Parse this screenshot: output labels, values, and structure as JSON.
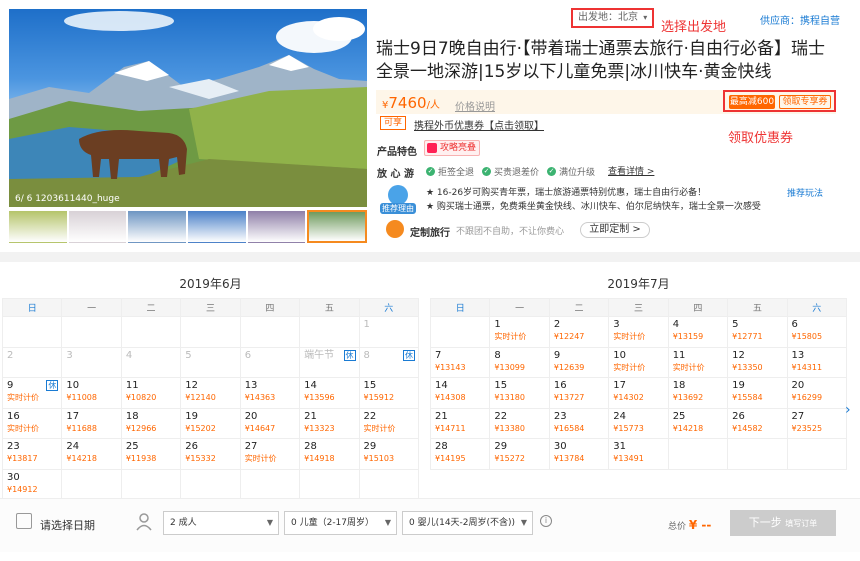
{
  "gallery": {
    "caption": "6/ 6 1203611440_huge",
    "thumb_colors": [
      "#b5c46a",
      "#d8d1d6",
      "#6d95c2",
      "#4a80c8",
      "#8f7fa8",
      "#6f9a5d"
    ]
  },
  "header": {
    "departure": "出发地：北京",
    "departure_annotation": "选择出发地",
    "supplier": "供应商：携程自营",
    "title": "瑞士9日7晚自由行·【带着瑞士通票去旅行·自由行必备】瑞士全景一地深游|15岁以下儿童免票|冰川快车·黄金快线"
  },
  "price": {
    "symbol": "¥",
    "amount": "7460",
    "unit": "/人",
    "note": "价格说明",
    "coupon_tag": "最高减600",
    "coupon_button": "领取专享券",
    "coupon_annotation": "领取优惠券",
    "ketao_tag": "可享",
    "ketao_text": "携程外币优惠券【点击领取】"
  },
  "features": {
    "label": "产品特色",
    "button": "攻略亮叠",
    "fangxin_label": "放 心 游",
    "items": [
      "拒签全退",
      "买贵退差价",
      "满位升级"
    ],
    "detail_link": "查看详情 >",
    "tips": [
      "★ 16-26岁可购买青年票，瑞士旅游通票特别优惠，瑞士自由行必备！",
      "★ 购买瑞士通票，免费乘坐黄金快线、冰川快车、伯尔尼纳快车，瑞士全景一次感受"
    ],
    "tip_badge": "推荐理由",
    "recommend_link": "推荐玩法",
    "custom_label": "定制旅行",
    "custom_sub": "不跟团不自助，不让你费心",
    "custom_button": "立即定制 >"
  },
  "calendar": {
    "weekdays": [
      "日",
      "一",
      "二",
      "三",
      "四",
      "五",
      "六"
    ],
    "june": {
      "title": "2019年6月",
      "rows": [
        [
          {
            "d": ""
          },
          {
            "d": ""
          },
          {
            "d": ""
          },
          {
            "d": ""
          },
          {
            "d": ""
          },
          {
            "d": ""
          },
          {
            "d": "1",
            "g": true
          }
        ],
        [
          {
            "d": "2",
            "g": true
          },
          {
            "d": "3",
            "g": true
          },
          {
            "d": "4",
            "g": true
          },
          {
            "d": "5",
            "g": true
          },
          {
            "d": "6",
            "g": true
          },
          {
            "d": "端午节",
            "g": true,
            "x": "休"
          },
          {
            "d": "8",
            "g": true,
            "x": "休"
          }
        ],
        [
          {
            "d": "9",
            "x": "休",
            "p": "实时计价"
          },
          {
            "d": "10",
            "p": "¥11008"
          },
          {
            "d": "11",
            "p": "¥10820"
          },
          {
            "d": "12",
            "p": "¥12140"
          },
          {
            "d": "13",
            "p": "¥14363"
          },
          {
            "d": "14",
            "p": "¥13596"
          },
          {
            "d": "15",
            "p": "¥15912"
          }
        ],
        [
          {
            "d": "16",
            "p": "实时计价"
          },
          {
            "d": "17",
            "p": "¥11688"
          },
          {
            "d": "18",
            "p": "¥12966"
          },
          {
            "d": "19",
            "p": "¥15202"
          },
          {
            "d": "20",
            "p": "¥14647"
          },
          {
            "d": "21",
            "p": "¥13323"
          },
          {
            "d": "22",
            "p": "实时计价"
          }
        ],
        [
          {
            "d": "23",
            "p": "¥13817"
          },
          {
            "d": "24",
            "p": "¥14218"
          },
          {
            "d": "25",
            "p": "¥11938"
          },
          {
            "d": "26",
            "p": "¥15332"
          },
          {
            "d": "27",
            "p": "实时计价"
          },
          {
            "d": "28",
            "p": "¥14918"
          },
          {
            "d": "29",
            "p": "¥15103"
          }
        ],
        [
          {
            "d": "30",
            "p": "¥14912"
          },
          {
            "d": ""
          },
          {
            "d": ""
          },
          {
            "d": ""
          },
          {
            "d": ""
          },
          {
            "d": ""
          },
          {
            "d": ""
          }
        ]
      ]
    },
    "july": {
      "title": "2019年7月",
      "rows": [
        [
          {
            "d": ""
          },
          {
            "d": "1",
            "p": "实时计价"
          },
          {
            "d": "2",
            "p": "¥12247"
          },
          {
            "d": "3",
            "p": "实时计价"
          },
          {
            "d": "4",
            "p": "¥13159"
          },
          {
            "d": "5",
            "p": "¥12771"
          },
          {
            "d": "6",
            "p": "¥15805"
          }
        ],
        [
          {
            "d": "7",
            "p": "¥13143"
          },
          {
            "d": "8",
            "p": "¥13099"
          },
          {
            "d": "9",
            "p": "¥12639"
          },
          {
            "d": "10",
            "p": "实时计价"
          },
          {
            "d": "11",
            "p": "实时计价"
          },
          {
            "d": "12",
            "p": "¥13350"
          },
          {
            "d": "13",
            "p": "¥14311"
          }
        ],
        [
          {
            "d": "14",
            "p": "¥14308"
          },
          {
            "d": "15",
            "p": "¥13180"
          },
          {
            "d": "16",
            "p": "¥13727"
          },
          {
            "d": "17",
            "p": "¥14302"
          },
          {
            "d": "18",
            "p": "¥13692"
          },
          {
            "d": "19",
            "p": "¥15584"
          },
          {
            "d": "20",
            "p": "¥16299"
          }
        ],
        [
          {
            "d": "21",
            "p": "¥14711"
          },
          {
            "d": "22",
            "p": "¥13380"
          },
          {
            "d": "23",
            "p": "¥16584"
          },
          {
            "d": "24",
            "p": "¥15773"
          },
          {
            "d": "25",
            "p": "¥14218"
          },
          {
            "d": "26",
            "p": "¥14582"
          },
          {
            "d": "27",
            "p": "¥23525"
          }
        ],
        [
          {
            "d": "28",
            "p": "¥14195"
          },
          {
            "d": "29",
            "p": "¥15272"
          },
          {
            "d": "30",
            "p": "¥13784"
          },
          {
            "d": "31",
            "p": "¥13491"
          },
          {
            "d": ""
          },
          {
            "d": ""
          },
          {
            "d": ""
          }
        ]
      ]
    },
    "next_arrow": "›"
  },
  "booking": {
    "select_date": "请选择日期",
    "adults": "2  成人",
    "children": "0  儿童（2-17周岁）",
    "infants": "0  婴儿(14天-2周岁(不含))",
    "caret": "▼",
    "info": "i",
    "total_label": "总价",
    "total_value": "¥ --",
    "next_label": "下一步",
    "next_sub": "填写订单"
  }
}
